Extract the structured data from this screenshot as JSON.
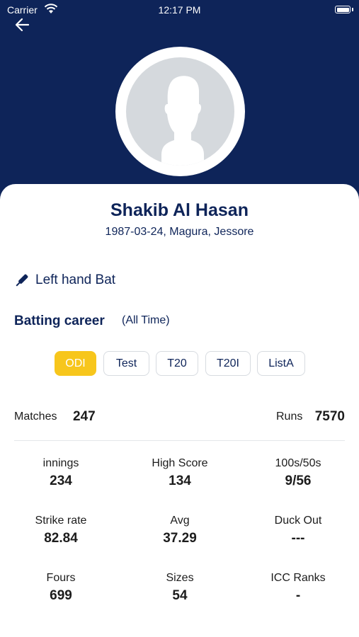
{
  "status_bar": {
    "carrier": "Carrier",
    "time": "12:17 PM"
  },
  "player": {
    "name": "Shakib Al Hasan",
    "born": "1987-03-24, Magura, Jessore",
    "batting_style": "Left hand Bat"
  },
  "career": {
    "title": "Batting career",
    "scope": "(All Time)",
    "tabs": [
      "ODI",
      "Test",
      "T20",
      "T20I",
      "ListA"
    ],
    "active_tab": "ODI"
  },
  "summary": {
    "matches_label": "Matches",
    "matches": "247",
    "runs_label": "Runs",
    "runs": "7570"
  },
  "stats": [
    {
      "label": "innings",
      "value": "234"
    },
    {
      "label": "High Score",
      "value": "134"
    },
    {
      "label": "100s/50s",
      "value": "9/56"
    },
    {
      "label": "Strike rate",
      "value": "82.84"
    },
    {
      "label": "Avg",
      "value": "37.29"
    },
    {
      "label": "Duck Out",
      "value": "---"
    },
    {
      "label": "Fours",
      "value": "699"
    },
    {
      "label": "Sizes",
      "value": "54"
    },
    {
      "label": "ICC Ranks",
      "value": "-"
    }
  ],
  "colors": {
    "header": "#0e2459",
    "accent": "#f7c61c",
    "text": "#1c1c1c"
  },
  "icons": {
    "back": "arrow-left-icon",
    "bat": "cricket-bat-icon",
    "avatar": "person-silhouette-icon"
  }
}
